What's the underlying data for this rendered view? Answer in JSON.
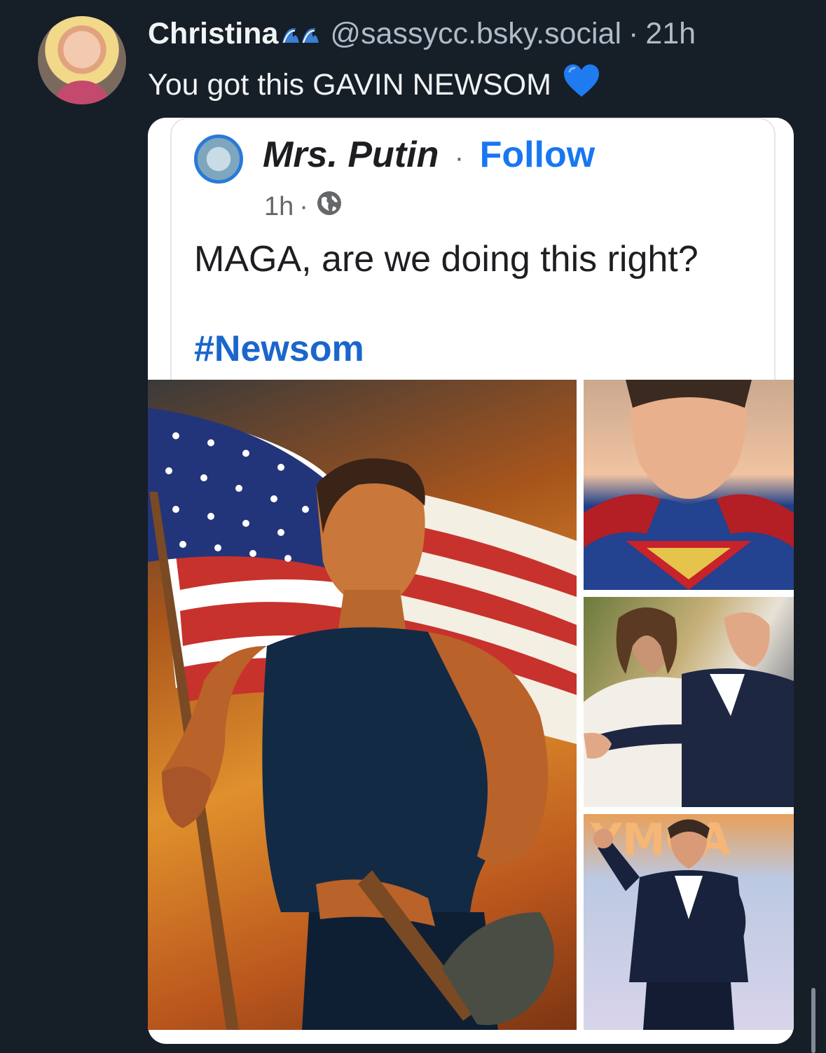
{
  "post": {
    "author_name": "Christina",
    "author_emoji": "wave-icon",
    "handle": "@sassycc.bsky.social",
    "separator": "·",
    "time": "21h",
    "text": "You got this GAVIN NEWSOM",
    "text_emoji": "blue-heart-icon"
  },
  "embed": {
    "facebook_post": {
      "page_name": "Mrs. Putin",
      "separator": "·",
      "follow_label": "Follow",
      "time": "1h",
      "meta_separator": "·",
      "audience_icon": "globe-icon",
      "message": "MAGA, are we doing this right?",
      "hashtag": "#Newsom"
    },
    "photos": [
      "Painted image of a muscular man in a navy tank top holding an American flag and a shovel",
      "Man wearing a Superman costume",
      "Man in a suit embracing a figure in white robes",
      "Man in a suit raising a fist in front of a YMCA sign"
    ],
    "photo_sign_text": "YMCA"
  },
  "colors": {
    "background": "#161e27",
    "text_primary": "#f1f3f5",
    "text_secondary": "#aebbc9",
    "facebook_blue": "#1877f2",
    "hashtag_blue": "#1a66cc",
    "heart_blue": "#1e7cf0"
  }
}
